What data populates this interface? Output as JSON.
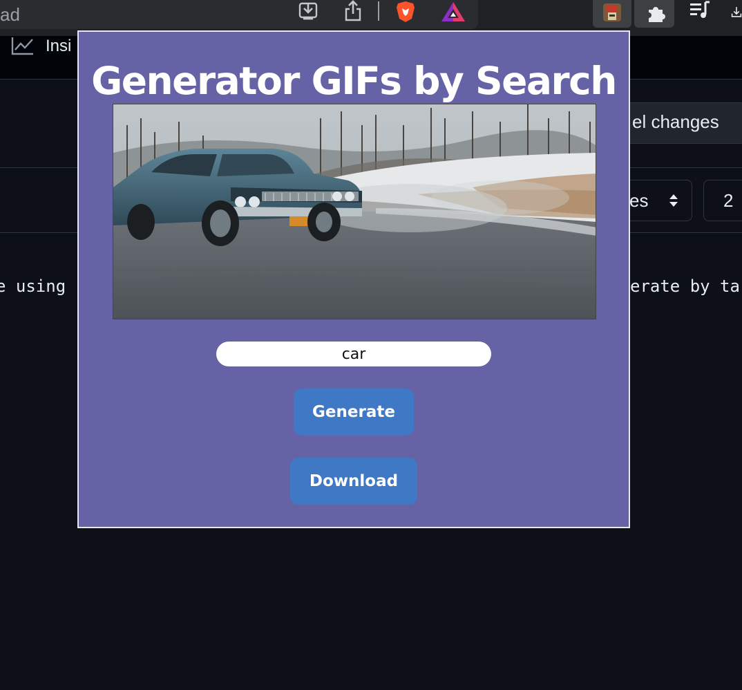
{
  "browser": {
    "omnibox_text": "ad",
    "icons": [
      "install-icon",
      "share-icon",
      "brave-shields-icon",
      "brave-rewards-icon",
      "gif-extension-icon",
      "extensions-puzzle-icon",
      "media-queue-icon",
      "download-icon"
    ]
  },
  "github": {
    "nav": {
      "insights_label": "Insi"
    },
    "cancel_button_label": "el changes",
    "select_value": "es",
    "number_value": "2",
    "code_left": "e using F",
    "code_right": "erate by ta"
  },
  "popup": {
    "title": "Generator GIFs by Search",
    "search": {
      "value": "car"
    },
    "generate_label": "Generate",
    "download_label": "Download"
  },
  "colors": {
    "popup_bg": "#6562a6",
    "button_bg": "#3f78c4",
    "page_bg": "#0d1117"
  }
}
